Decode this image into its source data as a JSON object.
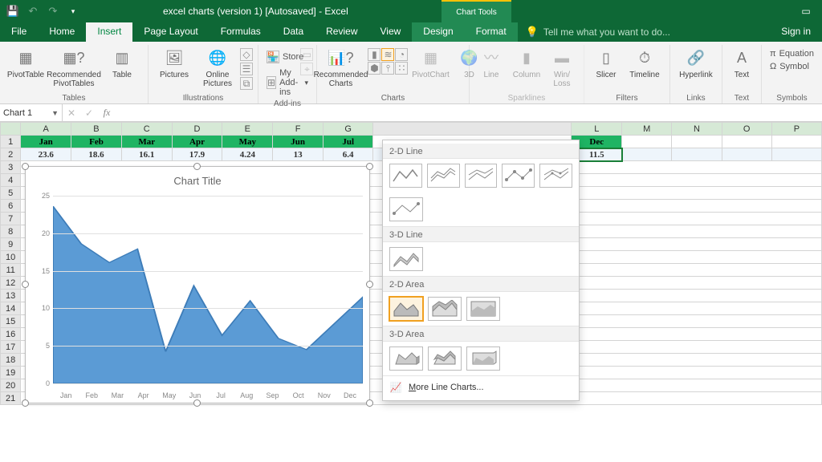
{
  "app": {
    "title": "excel charts (version 1) [Autosaved] - Excel",
    "tools_super": "Chart Tools",
    "signin": "Sign in",
    "tell_me": "Tell me what you want to do..."
  },
  "tabs": [
    "File",
    "Home",
    "Insert",
    "Page Layout",
    "Formulas",
    "Data",
    "Review",
    "View",
    "Design",
    "Format"
  ],
  "ribbon": {
    "groups": {
      "tables": "Tables",
      "illustrations": "Illustrations",
      "addins": "Add-ins",
      "charts": "Charts",
      "sparklines": "Sparklines",
      "filters": "Filters",
      "links": "Links",
      "text": "Text",
      "symbols": "Symbols"
    },
    "btn": {
      "pivottable": "PivotTable",
      "recpivot": "Recommended PivotTables",
      "table": "Table",
      "pictures": "Pictures",
      "onlinepics": "Online Pictures",
      "store": "Store",
      "myaddins": "My Add-ins",
      "reccharts": "Recommended Charts",
      "pivotchart": "PivotChart",
      "threed": "3D",
      "line": "Line",
      "column": "Column",
      "winloss": "Win/ Loss",
      "slicer": "Slicer",
      "timeline": "Timeline",
      "hyperlink": "Hyperlink",
      "text": "Text",
      "equation": "Equation",
      "symbol": "Symbol"
    }
  },
  "chart_menu": {
    "hdr_2dline": "2-D Line",
    "hdr_3dline": "3-D Line",
    "hdr_2darea": "2-D Area",
    "hdr_3darea": "3-D Area",
    "more": "More Line Charts..."
  },
  "namebox": "Chart 1",
  "columns": [
    "A",
    "B",
    "C",
    "D",
    "E",
    "F",
    "G",
    "L",
    "M",
    "N",
    "O",
    "P"
  ],
  "months": [
    "Jan",
    "Feb",
    "Mar",
    "Apr",
    "May",
    "Jun",
    "Jul",
    "Dec"
  ],
  "values_row": [
    "23.6",
    "18.6",
    "16.1",
    "17.9",
    "4.24",
    "13",
    "6.4",
    "11.5"
  ],
  "chart_data": {
    "type": "area",
    "title": "Chart Title",
    "categories": [
      "Jan",
      "Feb",
      "Mar",
      "Apr",
      "May",
      "Jun",
      "Jul",
      "Aug",
      "Sep",
      "Oct",
      "Nov",
      "Dec"
    ],
    "values": [
      23.6,
      18.6,
      16.1,
      17.9,
      4.24,
      13,
      6.4,
      11,
      6,
      4.5,
      8,
      11.5
    ],
    "ylim": [
      0,
      25
    ],
    "yticks": [
      0,
      5,
      10,
      15,
      20,
      25
    ],
    "xlabel": "",
    "ylabel": ""
  },
  "colors": {
    "accent": "#0e6836",
    "series": "#5b9bd5",
    "header_row": "#1fb463"
  }
}
